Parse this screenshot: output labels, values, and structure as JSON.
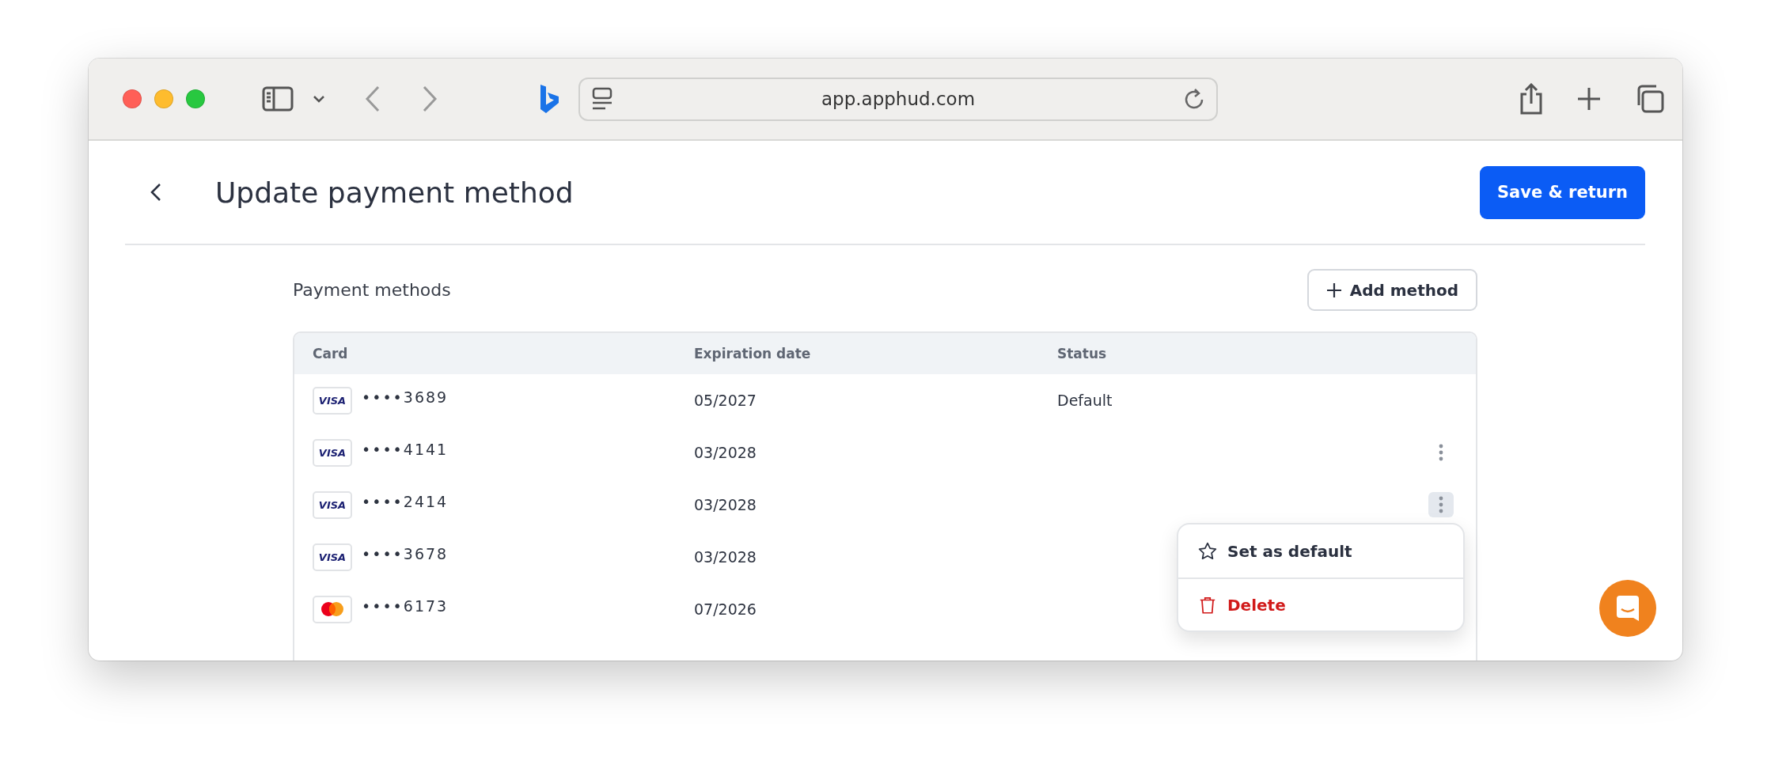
{
  "browser": {
    "url": "app.apphud.com"
  },
  "page": {
    "title": "Update payment method",
    "save_button": "Save & return"
  },
  "section": {
    "title": "Payment methods",
    "add_button": "Add method"
  },
  "table": {
    "columns": [
      "Card",
      "Expiration date",
      "Status"
    ],
    "rows": [
      {
        "kind": "visa",
        "logo_text": "VISA",
        "number": "••••3689",
        "expiration": "05/2027",
        "status": "Default",
        "menu_button": false
      },
      {
        "kind": "visa",
        "logo_text": "VISA",
        "number": "••••4141",
        "expiration": "03/2028",
        "menu_button": true,
        "selected": false
      },
      {
        "kind": "visa",
        "logo_text": "VISA",
        "number": "••••2414",
        "expiration": "03/2028",
        "menu_button": true,
        "selected": true
      },
      {
        "kind": "visa",
        "logo_text": "VISA",
        "number": "••••3678",
        "expiration": "03/2028",
        "menu_button": false
      },
      {
        "kind": "mastercard",
        "number": "••••6173",
        "expiration": "07/2026",
        "menu_button": false
      }
    ]
  },
  "context_menu": {
    "items": [
      {
        "kind": "default",
        "label": "Set as default"
      },
      {
        "kind": "delete",
        "label": "Delete"
      }
    ]
  }
}
